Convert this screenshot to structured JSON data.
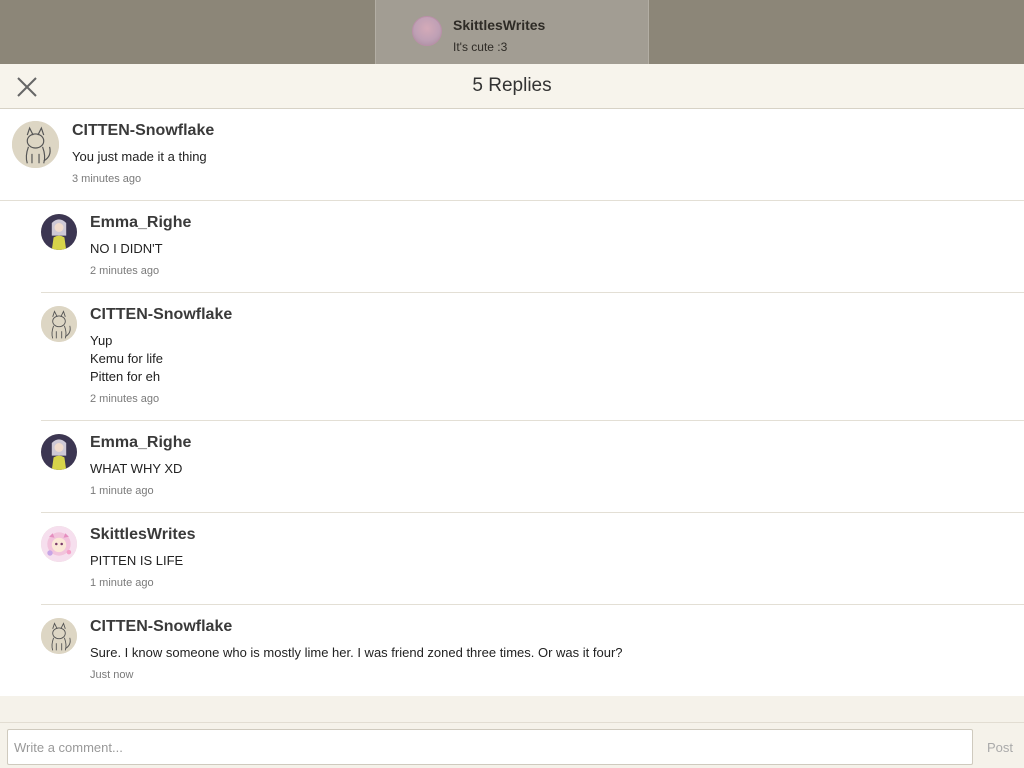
{
  "background_preview": {
    "author": "SkittlesWrites",
    "text": "It's cute :3"
  },
  "header": {
    "title": "5 Replies",
    "close_icon": "close-icon"
  },
  "root_comment": {
    "author": "CITTEN-Snowflake",
    "lines": [
      "You just made it a thing"
    ],
    "time": "3 minutes ago",
    "avatar": "cat-sketch-avatar"
  },
  "replies": [
    {
      "author": "Emma_Righe",
      "lines": [
        "NO I DIDN'T"
      ],
      "time": "2 minutes ago",
      "avatar": "anime-girl-avatar"
    },
    {
      "author": "CITTEN-Snowflake",
      "lines": [
        "Yup",
        "Kemu for life",
        "Pitten for eh"
      ],
      "time": "2 minutes ago",
      "avatar": "cat-sketch-avatar"
    },
    {
      "author": "Emma_Righe",
      "lines": [
        "WHAT WHY XD"
      ],
      "time": "1 minute ago",
      "avatar": "anime-girl-avatar"
    },
    {
      "author": "SkittlesWrites",
      "lines": [
        "PITTEN IS LIFE"
      ],
      "time": "1 minute ago",
      "avatar": "pink-character-avatar"
    },
    {
      "author": "CITTEN-Snowflake",
      "lines": [
        "Sure. I know someone who is mostly lime her. I was friend zoned three times. Or was it four?"
      ],
      "time": "Just now",
      "avatar": "cat-sketch-avatar"
    }
  ],
  "composer": {
    "placeholder": "Write a comment...",
    "post_label": "Post"
  },
  "colors": {
    "backdrop": "#8c8678",
    "panel": "#f5f2ea",
    "list_bg": "#ffffff",
    "divider": "#e3dfd5"
  }
}
